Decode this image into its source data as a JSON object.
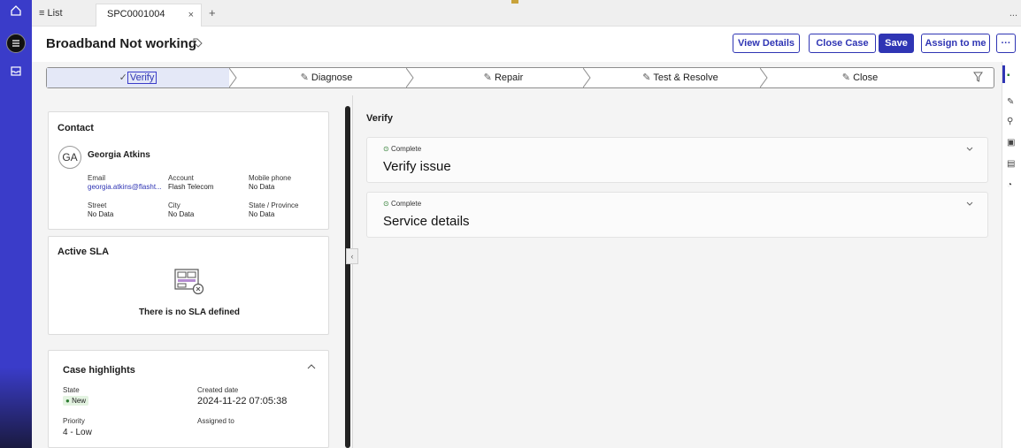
{
  "tabbar": {
    "list_label": "≡ List",
    "active_tab": "SPC0001004",
    "close_glyph": "×",
    "add_glyph": "+",
    "more_glyph": "..."
  },
  "header": {
    "title": "Broadband Not working",
    "buttons": {
      "view_details": "View Details",
      "close_case": "Close Case",
      "save": "Save",
      "assign_to_me": "Assign to me",
      "more": "···"
    }
  },
  "process": {
    "steps": [
      "Verify",
      "Diagnose",
      "Repair",
      "Test & Resolve",
      "Close"
    ],
    "active_step": "Verify"
  },
  "contact_card": {
    "title": "Contact",
    "avatar_initials": "GA",
    "name": "Georgia Atkins",
    "fields": {
      "email_label": "Email",
      "email_value": "georgia.atkins@flasht...",
      "account_label": "Account",
      "account_value": "Flash Telecom",
      "mobile_label": "Mobile phone",
      "mobile_value": "No Data",
      "street_label": "Street",
      "street_value": "No Data",
      "city_label": "City",
      "city_value": "No Data",
      "state_label": "State / Province",
      "state_value": "No Data"
    }
  },
  "sla_card": {
    "title": "Active SLA",
    "empty_text": "There is no SLA defined"
  },
  "highlights_card": {
    "title": "Case highlights",
    "state_label": "State",
    "state_value": "New",
    "created_label": "Created date",
    "created_value": "2024-11-22 07:05:38",
    "priority_label": "Priority",
    "priority_value": "4 - Low",
    "assigned_label": "Assigned to"
  },
  "main": {
    "section_title": "Verify",
    "accordions": [
      {
        "status": "Complete",
        "title": "Verify issue"
      },
      {
        "status": "Complete",
        "title": "Service details"
      }
    ]
  },
  "colors": {
    "brand": "#3a3cc9",
    "button_primary": "#2f35b4",
    "status_new": "#2e7d32"
  }
}
